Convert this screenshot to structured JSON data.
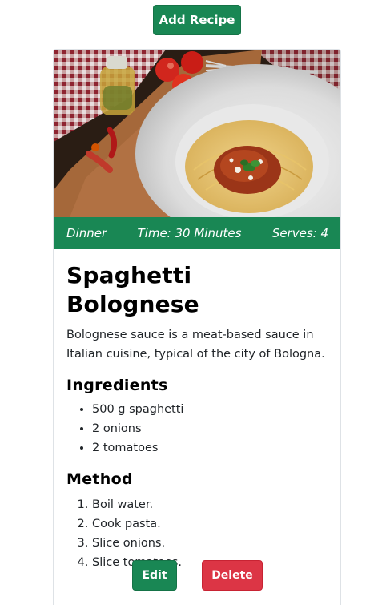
{
  "toolbar": {
    "add_label": "Add Recipe"
  },
  "recipe": {
    "image_alt": "Spaghetti Bolognese photo",
    "meta": {
      "category": "Dinner",
      "time": "Time: 30 Minutes",
      "serves": "Serves: 4"
    },
    "title": "Spaghetti Bolognese",
    "description": "Bolognese sauce is a meat-based sauce in Italian cuisine, typical of the city of Bologna.",
    "ingredients_heading": "Ingredients",
    "ingredients": [
      "500 g spaghetti",
      "2 onions",
      "2 tomatoes"
    ],
    "method_heading": "Method",
    "method": [
      "Boil water.",
      "Cook pasta.",
      "Slice onions.",
      "Slice tomatoes."
    ],
    "actions": {
      "edit_label": "Edit",
      "delete_label": "Delete"
    }
  },
  "colors": {
    "primary": "#198754",
    "danger": "#dc3545"
  }
}
